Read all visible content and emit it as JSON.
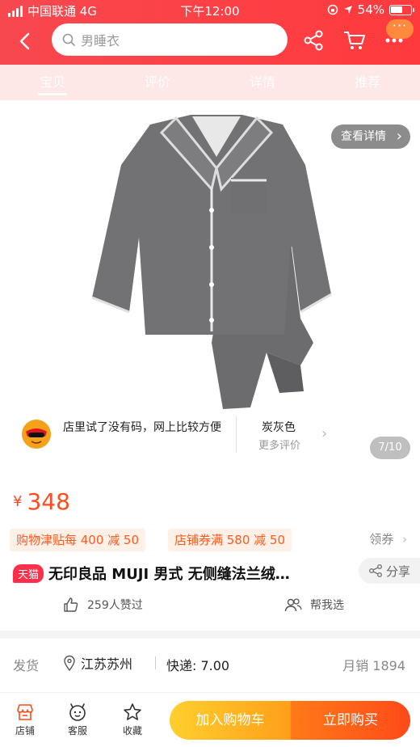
{
  "status_bar": {
    "carrier": "中国联通 4G",
    "time": "下午12:00",
    "battery": "54%"
  },
  "nav": {
    "search_placeholder": "男睡衣",
    "more_badge": "···"
  },
  "tabs": [
    {
      "label": "宝贝",
      "active": true
    },
    {
      "label": "评价",
      "active": false
    },
    {
      "label": "详情",
      "active": false
    },
    {
      "label": "推荐",
      "active": false
    }
  ],
  "gallery": {
    "view_detail": "查看详情",
    "counter": "7/10"
  },
  "review": {
    "text": "店里试了没有码，网上比较方便",
    "color": "炭灰色",
    "more": "更多评价"
  },
  "price": {
    "currency": "¥",
    "value": "348"
  },
  "coupons": {
    "item1": "购物津贴每 400 减 50",
    "item2": "店铺券满 580 减 50",
    "claim": "领券"
  },
  "product": {
    "badge": "天猫",
    "title": "无印良品 MUJI 男式 无侧缝法兰绒…",
    "share": "分享"
  },
  "social": {
    "likes": "259人赞过",
    "help": "帮我选"
  },
  "shipping": {
    "label": "发货",
    "location": "江苏苏州",
    "fee": "快递: 7.00",
    "monthly_sales": "月销 1894"
  },
  "bottom_bar": {
    "shop": "店铺",
    "service": "客服",
    "favorite": "收藏",
    "add_to_cart": "加入购物车",
    "buy_now": "立即购买"
  },
  "colors": {
    "brand_red": "#ff3a3d",
    "price_orange": "#ff4b1f",
    "cart_yellow": "#ffb81f",
    "buy_orange": "#ff5a1a"
  }
}
